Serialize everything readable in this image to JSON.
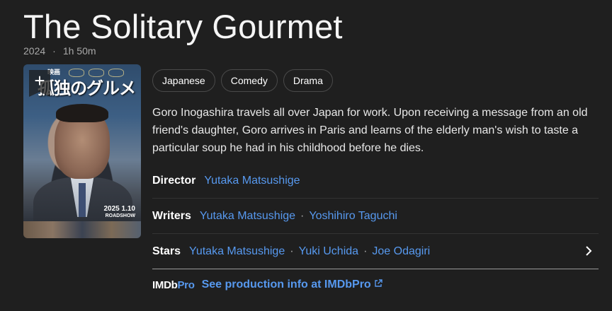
{
  "title": "The Solitary Gourmet",
  "meta": {
    "year": "2024",
    "separator": "·",
    "runtime": "1h 50m"
  },
  "poster": {
    "jp_small": "映画",
    "jp_title": "孤独のグルメ",
    "date_line1": "2025 1.10",
    "date_line2": "ROADSHOW",
    "add_symbol": "+"
  },
  "genres": [
    "Japanese",
    "Comedy",
    "Drama"
  ],
  "plot": "Goro Inogashira travels all over Japan for work. Upon receiving a message from an old friend's daughter, Goro arrives in Paris and learns of the elderly man's wish to taste a particular soup he had in his childhood before he dies.",
  "credits": {
    "director": {
      "role": "Director",
      "names": [
        "Yutaka Matsushige"
      ]
    },
    "writers": {
      "role": "Writers",
      "names": [
        "Yutaka Matsushige",
        "Yoshihiro Taguchi"
      ]
    },
    "stars": {
      "role": "Stars",
      "names": [
        "Yutaka Matsushige",
        "Yuki Uchida",
        "Joe Odagiri"
      ]
    },
    "separator": "·"
  },
  "imdbpro": {
    "logo_a": "IMDb",
    "logo_b": "Pro",
    "link_text": "See production info at IMDbPro"
  },
  "colors": {
    "background": "#1f1f1f",
    "link": "#5799ef",
    "muted": "#a9a9a9"
  },
  "icons": {
    "add": "plus-ribbon-icon",
    "chevron": "chevron-right-icon",
    "external": "external-link-icon"
  }
}
